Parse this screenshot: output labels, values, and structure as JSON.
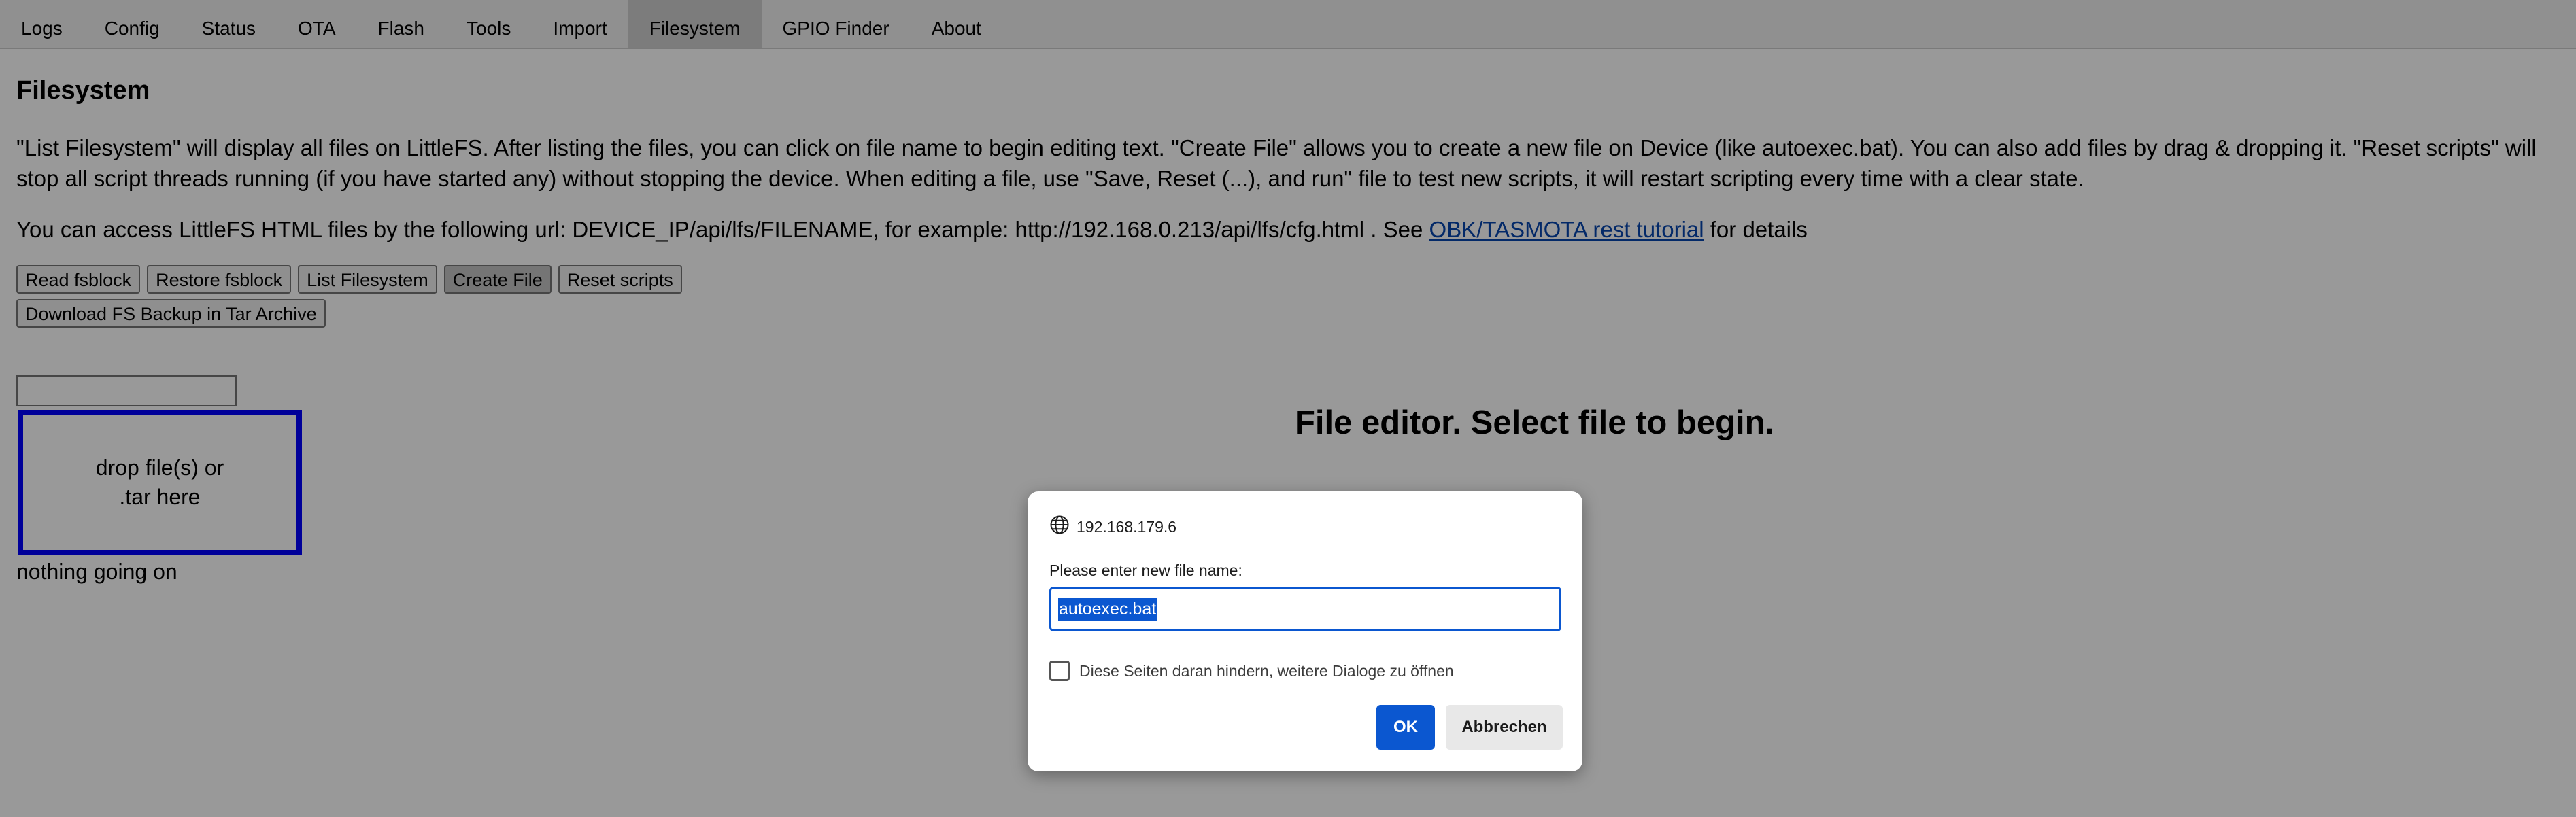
{
  "tabs": [
    {
      "label": "Logs"
    },
    {
      "label": "Config"
    },
    {
      "label": "Status"
    },
    {
      "label": "OTA"
    },
    {
      "label": "Flash"
    },
    {
      "label": "Tools"
    },
    {
      "label": "Import"
    },
    {
      "label": "Filesystem",
      "active": true
    },
    {
      "label": "GPIO Finder"
    },
    {
      "label": "About"
    }
  ],
  "page": {
    "title": "Filesystem",
    "description": "\"List Filesystem\" will display all files on LittleFS. After listing the files, you can click on file name to begin editing text. \"Create File\" allows you to create a new file on Device (like autoexec.bat). You can also add files by drag & dropping it. \"Reset scripts\" will stop all script threads running (if you have started any) without stopping the device. When editing a file, use \"Save, Reset (...), and run\" file to test new scripts, it will restart scripting every time with a clear state.",
    "access_prefix": "You can access LittleFS HTML files by the following url: DEVICE_IP/api/lfs/FILENAME, for example: http://192.168.0.213/api/lfs/cfg.html . See ",
    "access_link": "OBK/TASMOTA rest tutorial",
    "access_suffix": " for details"
  },
  "buttons": {
    "read_fsblock": "Read fsblock",
    "restore_fsblock": "Restore fsblock",
    "list_filesystem": "List Filesystem",
    "create_file": "Create File",
    "reset_scripts": "Reset scripts",
    "download_backup": "Download FS Backup in Tar Archive"
  },
  "dropzone": {
    "line1": "drop file(s) or",
    "line2": ".tar here"
  },
  "status_text": "nothing going on",
  "editor_title": "File editor. Select file to begin.",
  "dialog": {
    "origin": "192.168.179.6",
    "prompt": "Please enter new file name:",
    "input_value": "autoexec.bat",
    "checkbox_label": "Diese Seiten daran hindern, weitere Dialoge zu öffnen",
    "ok_label": "OK",
    "cancel_label": "Abbrechen"
  },
  "colors": {
    "dropzone_border": "#0000ff",
    "accent": "#0b57d0",
    "link": "#0645ad"
  }
}
